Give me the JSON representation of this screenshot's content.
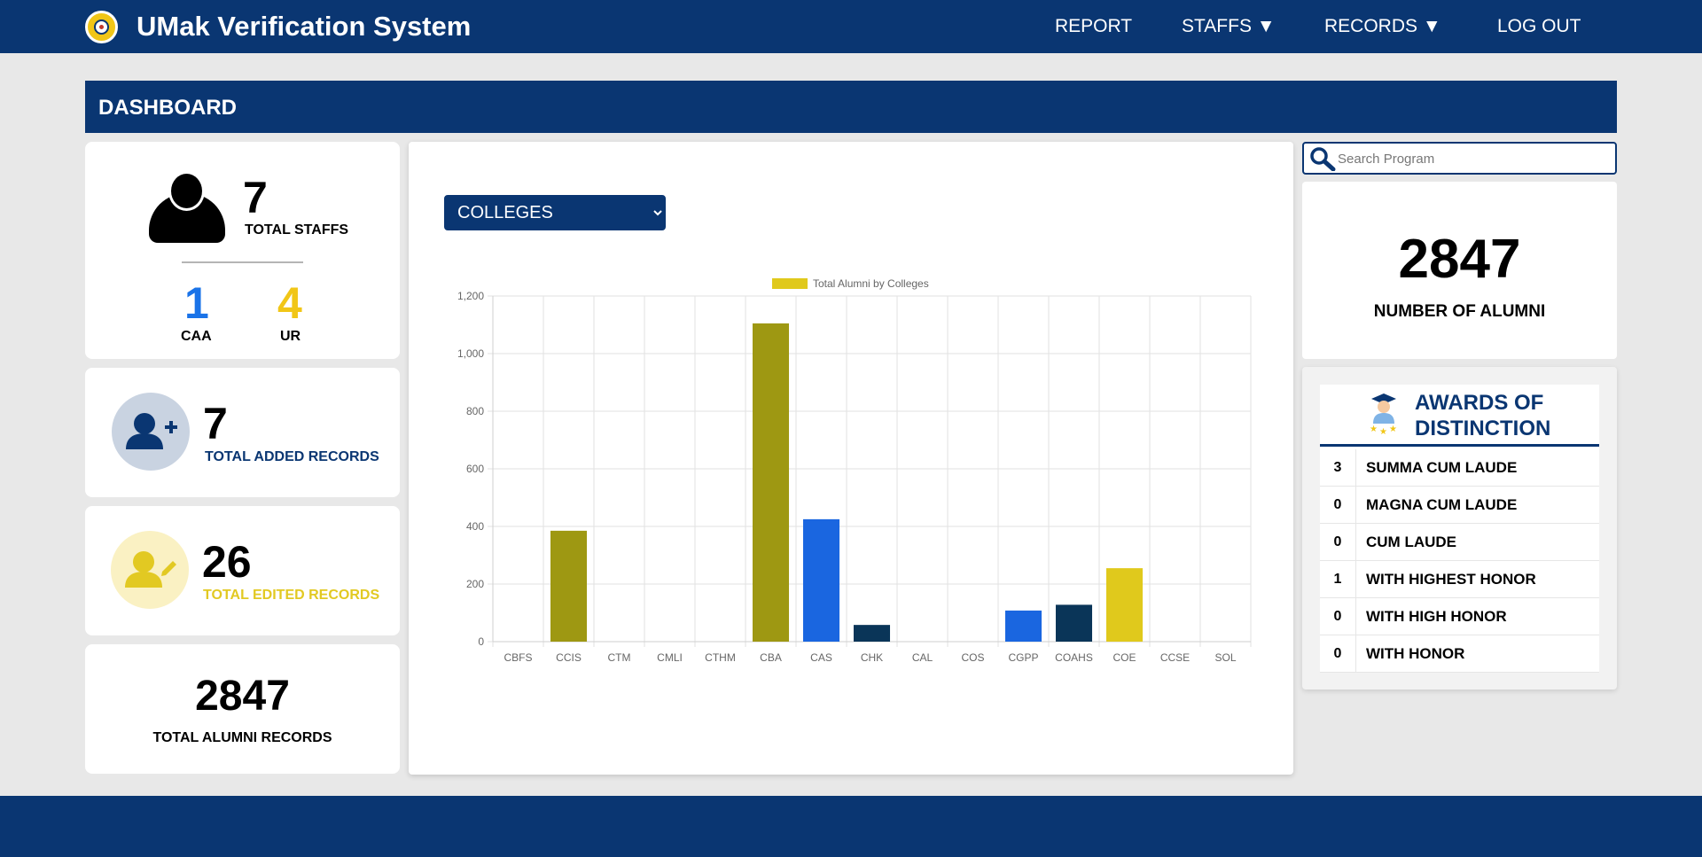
{
  "header": {
    "title": "UMak Verification System",
    "nav": [
      "REPORT",
      "STAFFS ▼",
      "RECORDS ▼",
      "LOG OUT"
    ]
  },
  "banner": {
    "title": "DASHBOARD"
  },
  "staff_card": {
    "total": "7",
    "total_label": "TOTAL STAFFS",
    "caa_count": "1",
    "caa_label": "CAA",
    "ur_count": "4",
    "ur_label": "UR"
  },
  "added_card": {
    "count": "7",
    "label": "TOTAL ADDED RECORDS"
  },
  "edited_card": {
    "count": "26",
    "label": "TOTAL EDITED RECORDS"
  },
  "alumni_records_card": {
    "count": "2847",
    "label": "TOTAL ALUMNI RECORDS"
  },
  "filter": {
    "selected": "COLLEGES"
  },
  "search": {
    "placeholder": "Search Program"
  },
  "alumni_card": {
    "count": "2847",
    "label": "NUMBER OF ALUMNI"
  },
  "awards": {
    "title": "AWARDS OF DISTINCTION",
    "items": [
      {
        "count": "3",
        "name": "SUMMA CUM LAUDE"
      },
      {
        "count": "0",
        "name": "MAGNA CUM LAUDE"
      },
      {
        "count": "0",
        "name": "CUM LAUDE"
      },
      {
        "count": "1",
        "name": "WITH HIGHEST HONOR"
      },
      {
        "count": "0",
        "name": "WITH HIGH HONOR"
      },
      {
        "count": "0",
        "name": "WITH HONOR"
      }
    ]
  },
  "colors": {
    "primary": "#0a3672",
    "caa_blue": "#1a73e8",
    "ur_yellow": "#f1c617",
    "edited_yellow": "#e2c922",
    "olive": "#9e9812",
    "bar_blue": "#1a66e0",
    "bar_navy": "#0a3558",
    "bar_yellow": "#e0c91c"
  },
  "chart_data": {
    "type": "bar",
    "legend": "Total Alumni by Colleges",
    "legend_position": "top",
    "categories": [
      "CBFS",
      "CCIS",
      "CTM",
      "CMLI",
      "CTHM",
      "CBA",
      "CAS",
      "CHK",
      "CAL",
      "COS",
      "CGPP",
      "COAHS",
      "COE",
      "CCSE",
      "SOL"
    ],
    "values": [
      0,
      385,
      0,
      0,
      0,
      1105,
      425,
      58,
      0,
      0,
      108,
      128,
      255,
      0,
      0
    ],
    "bar_colors": [
      "#9e9812",
      "#9e9812",
      "#9e9812",
      "#9e9812",
      "#9e9812",
      "#9e9812",
      "#1a66e0",
      "#0a3558",
      "#0a3558",
      "#0a3558",
      "#1a66e0",
      "#0a3558",
      "#e0c91c",
      "#e0c91c",
      "#e0c91c"
    ],
    "ylim": [
      0,
      1200
    ],
    "yticks": [
      0,
      200,
      400,
      600,
      800,
      1000,
      1200
    ],
    "ytick_labels": [
      "0",
      "200",
      "400",
      "600",
      "800",
      "1,000",
      "1,200"
    ],
    "grid": true
  }
}
